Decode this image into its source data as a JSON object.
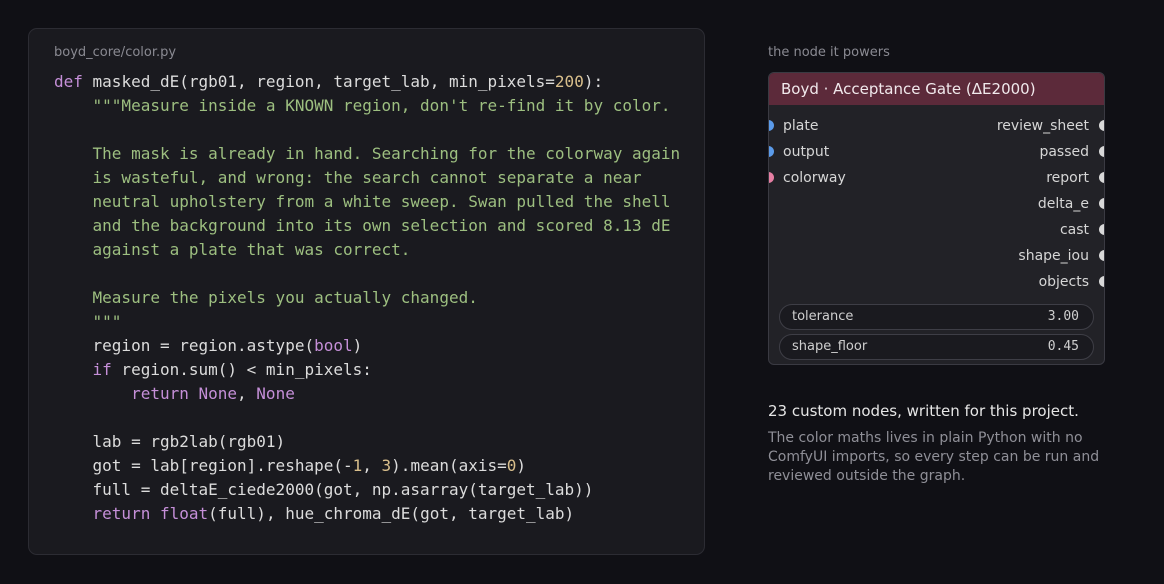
{
  "code_panel": {
    "filename": "boyd_core/color.py",
    "lines": [
      [
        {
          "t": "kw",
          "v": "def"
        },
        {
          "t": "plain",
          "v": " masked_dE(rgb01, region, target_lab, min_pixels="
        },
        {
          "t": "num",
          "v": "200"
        },
        {
          "t": "plain",
          "v": "):"
        }
      ],
      [
        {
          "t": "plain",
          "v": "    "
        },
        {
          "t": "str",
          "v": "\"\"\"Measure inside a KNOWN region, don't re-find it by color."
        }
      ],
      [],
      [
        {
          "t": "str",
          "v": "    The mask is already in hand. Searching for the colorway again"
        }
      ],
      [
        {
          "t": "str",
          "v": "    is wasteful, and wrong: the search cannot separate a near"
        }
      ],
      [
        {
          "t": "str",
          "v": "    neutral upholstery from a white sweep. Swan pulled the shell"
        }
      ],
      [
        {
          "t": "str",
          "v": "    and the background into its own selection and scored 8.13 dE"
        }
      ],
      [
        {
          "t": "str",
          "v": "    against a plate that was correct."
        }
      ],
      [],
      [
        {
          "t": "str",
          "v": "    Measure the pixels you actually changed."
        }
      ],
      [
        {
          "t": "str",
          "v": "    \"\"\""
        }
      ],
      [
        {
          "t": "plain",
          "v": "    region = region.astype("
        },
        {
          "t": "kw",
          "v": "bool"
        },
        {
          "t": "plain",
          "v": ")"
        }
      ],
      [
        {
          "t": "plain",
          "v": "    "
        },
        {
          "t": "kw",
          "v": "if"
        },
        {
          "t": "plain",
          "v": " region.sum() < min_pixels:"
        }
      ],
      [
        {
          "t": "plain",
          "v": "        "
        },
        {
          "t": "kw",
          "v": "return None"
        },
        {
          "t": "plain",
          "v": ", "
        },
        {
          "t": "kw",
          "v": "None"
        }
      ],
      [],
      [
        {
          "t": "plain",
          "v": "    lab = rgb2lab(rgb01)"
        }
      ],
      [
        {
          "t": "plain",
          "v": "    got = lab[region].reshape(-"
        },
        {
          "t": "num",
          "v": "1"
        },
        {
          "t": "plain",
          "v": ", "
        },
        {
          "t": "num",
          "v": "3"
        },
        {
          "t": "plain",
          "v": ").mean(axis="
        },
        {
          "t": "num",
          "v": "0"
        },
        {
          "t": "plain",
          "v": ")"
        }
      ],
      [
        {
          "t": "plain",
          "v": "    full = deltaE_ciede2000(got, np.asarray(target_lab))"
        }
      ],
      [
        {
          "t": "plain",
          "v": "    "
        },
        {
          "t": "kw",
          "v": "return"
        },
        {
          "t": "plain",
          "v": " "
        },
        {
          "t": "kw",
          "v": "float"
        },
        {
          "t": "plain",
          "v": "(full), hue_chroma_dE(got, target_lab)"
        }
      ]
    ]
  },
  "node": {
    "caption": "the node it powers",
    "title": "Boyd · Acceptance Gate (ΔE2000)",
    "header_color": "#5c2a3a",
    "inputs": [
      {
        "label": "plate",
        "color": "#5b9bea"
      },
      {
        "label": "output",
        "color": "#5b9bea"
      },
      {
        "label": "colorway",
        "color": "#e67fa3"
      }
    ],
    "outputs": [
      {
        "label": "review_sheet",
        "color": "#d8d8d8"
      },
      {
        "label": "passed",
        "color": "#d8d8d8"
      },
      {
        "label": "report",
        "color": "#d8d8d8"
      },
      {
        "label": "delta_e",
        "color": "#d8d8d8"
      },
      {
        "label": "cast",
        "color": "#d8d8d8"
      },
      {
        "label": "shape_iou",
        "color": "#d8d8d8"
      },
      {
        "label": "objects",
        "color": "#d8d8d8"
      }
    ],
    "widgets": [
      {
        "label": "tolerance",
        "value": "3.00"
      },
      {
        "label": "shape_floor",
        "value": "0.45"
      }
    ]
  },
  "summary": {
    "heading": "23 custom nodes, written for this project.",
    "body": "The color maths lives in plain Python with no ComfyUI imports, so every step can be run and reviewed outside the graph."
  }
}
